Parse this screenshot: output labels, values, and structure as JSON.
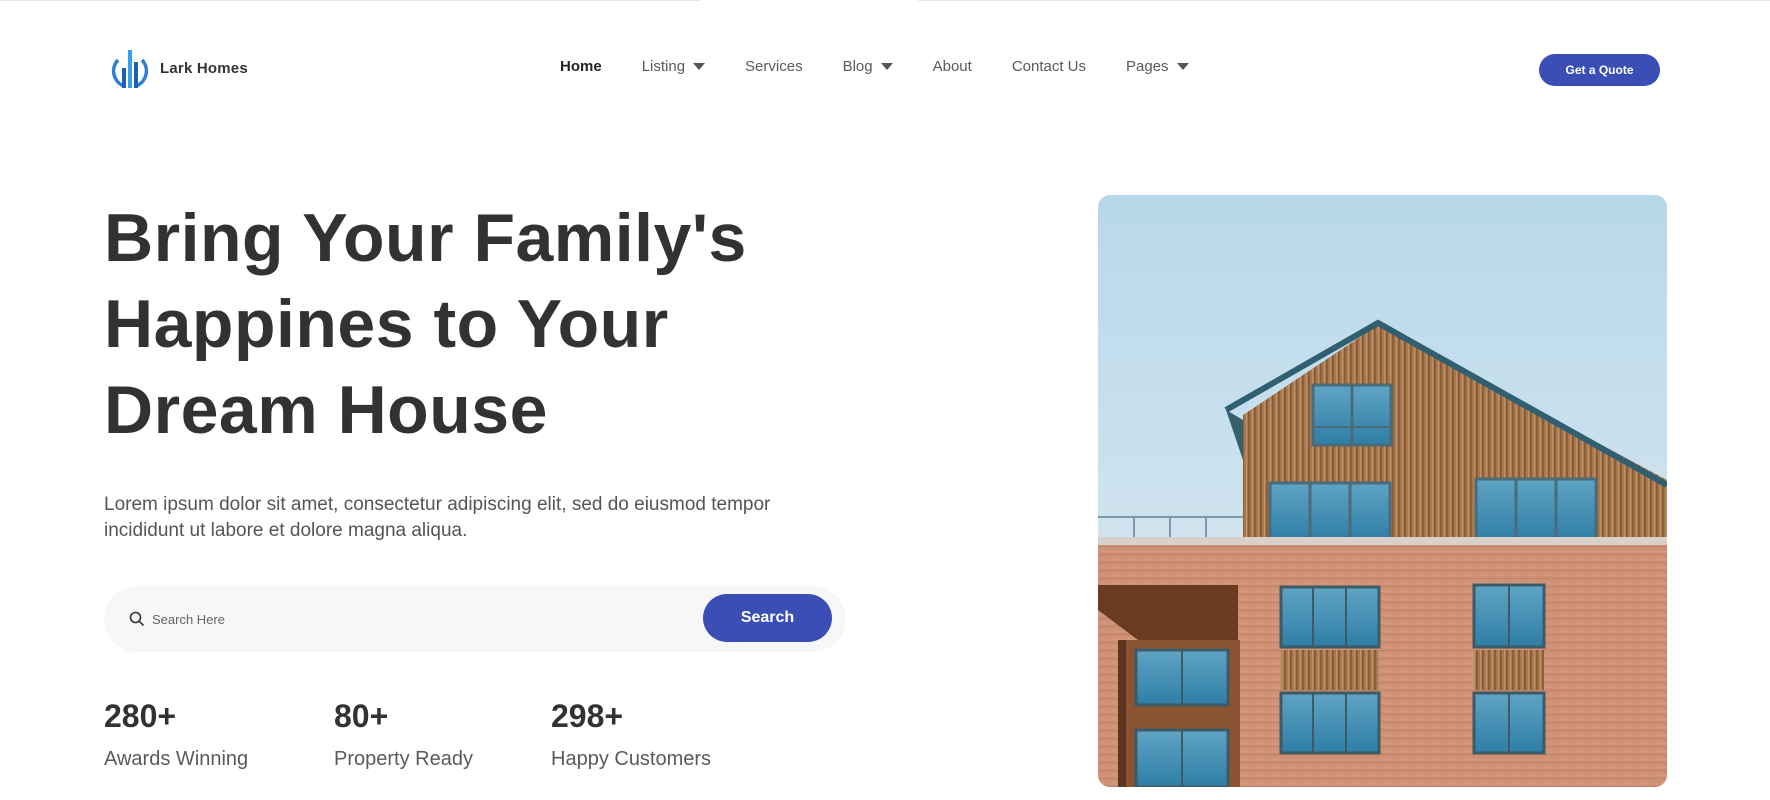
{
  "brand": {
    "name": "Lark Homes",
    "accent": "#3a4eb6"
  },
  "nav": {
    "items": [
      {
        "label": "Home",
        "active": true,
        "has_dropdown": false
      },
      {
        "label": "Listing",
        "active": false,
        "has_dropdown": true
      },
      {
        "label": "Services",
        "active": false,
        "has_dropdown": false
      },
      {
        "label": "Blog",
        "active": false,
        "has_dropdown": true
      },
      {
        "label": "About",
        "active": false,
        "has_dropdown": false
      },
      {
        "label": "Contact Us",
        "active": false,
        "has_dropdown": false
      },
      {
        "label": "Pages",
        "active": false,
        "has_dropdown": true
      }
    ],
    "cta_label": "Get a Quote"
  },
  "hero": {
    "title_lines": [
      "Bring Your Family's",
      "Happines to Your",
      "Dream House"
    ],
    "description": "Lorem ipsum dolor sit amet, consectetur adipiscing elit, sed do eiusmod tempor incididunt ut labore et dolore magna aliqua.",
    "search": {
      "placeholder": "Search Here",
      "value": "",
      "button_label": "Search"
    },
    "stats": [
      {
        "value": "280+",
        "label": "Awards Winning"
      },
      {
        "value": "80+",
        "label": "Property Ready"
      },
      {
        "value": "298+",
        "label": "Happy Customers"
      }
    ]
  },
  "icons": {
    "logo": "building-logo-icon",
    "search": "search-icon",
    "dropdown": "caret-down-icon"
  }
}
